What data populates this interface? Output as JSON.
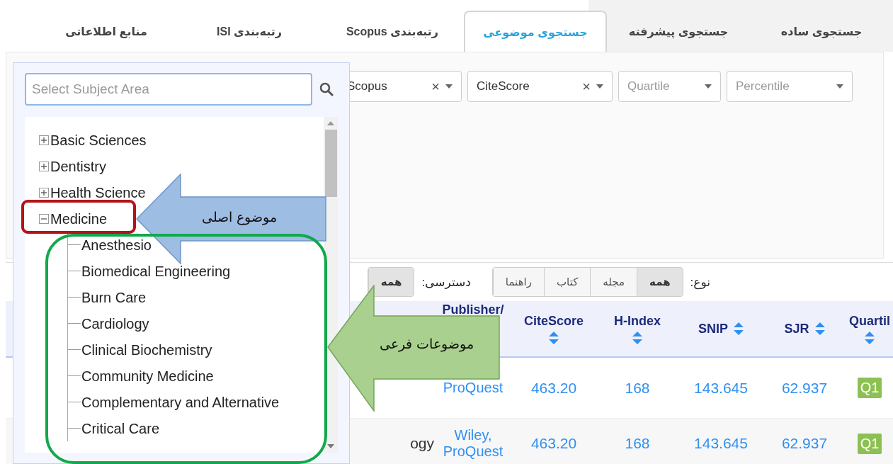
{
  "tabs": [
    {
      "label": "جستجوی ساده",
      "selected": false
    },
    {
      "label": "جستجوی پیشرفته",
      "selected": false
    },
    {
      "label": "جستجوی موضوعی",
      "selected": true
    },
    {
      "label": "رتبه‌بندی Scopus",
      "selected": false
    },
    {
      "label": "رتبه‌بندی ISI",
      "selected": false
    },
    {
      "label": "منابع اطلاعاتی",
      "selected": false
    }
  ],
  "filters": [
    {
      "kind": "value",
      "text": "Scopus",
      "clear": "×"
    },
    {
      "kind": "value",
      "text": "CiteScore",
      "clear": "×"
    },
    {
      "kind": "placeholder",
      "text": "Quartile"
    },
    {
      "kind": "placeholder",
      "text": "Percentile"
    }
  ],
  "toolbar": {
    "type_label": "نوع:",
    "type_options": [
      {
        "label": "همه",
        "selected": true
      },
      {
        "label": "مجله",
        "selected": false
      },
      {
        "label": "کتاب",
        "selected": false
      },
      {
        "label": "راهنما",
        "selected": false
      }
    ],
    "access_label": "دسترسی:",
    "access_options": [
      {
        "label": "همه",
        "selected": true
      }
    ]
  },
  "table": {
    "columns": [
      {
        "label": "Publisher/",
        "kind": "link",
        "sortable": false
      },
      {
        "label": "CiteScore",
        "kind": "number",
        "sortable": true
      },
      {
        "label": "H-Index",
        "kind": "number",
        "sortable": true
      },
      {
        "label": "SNIP",
        "kind": "number",
        "sortable": true
      },
      {
        "label": "SJR",
        "kind": "number",
        "sortable": true
      },
      {
        "label": "Quartil",
        "kind": "badge",
        "sortable": true
      }
    ],
    "rows": [
      {
        "cells": [
          "ProQuest",
          "463.20",
          "168",
          "143.645",
          "62.937",
          "Q1"
        ]
      },
      {
        "title": "ogy",
        "cells": [
          "Wiley, ProQuest",
          "463.20",
          "168",
          "143.645",
          "62.937",
          "Q1"
        ]
      }
    ]
  },
  "subject_picker": {
    "placeholder": "Select Subject Area",
    "tree": [
      {
        "label": "Basic Sciences",
        "expanded": false
      },
      {
        "label": "Dentistry",
        "expanded": false
      },
      {
        "label": "Health Science",
        "expanded": false
      },
      {
        "label": "Medicine",
        "expanded": true,
        "children": [
          {
            "label": "Anesthesio"
          },
          {
            "label": "Biomedical Engineering"
          },
          {
            "label": "Burn Care"
          },
          {
            "label": "Cardiology"
          },
          {
            "label": "Clinical Biochemistry"
          },
          {
            "label": "Community Medicine"
          },
          {
            "label": "Complementary and Alternative"
          },
          {
            "label": "Critical Care"
          }
        ]
      }
    ]
  },
  "annotations": [
    {
      "kind": "main",
      "text": "موضوع اصلی"
    },
    {
      "kind": "sub",
      "text": "موضوعات فرعی"
    }
  ]
}
